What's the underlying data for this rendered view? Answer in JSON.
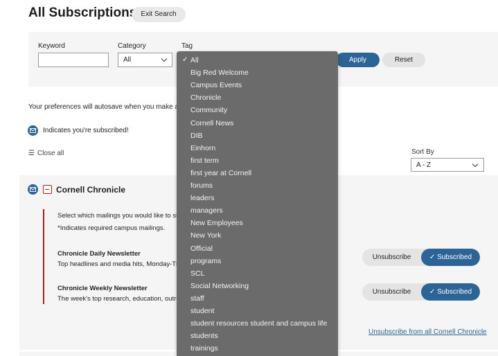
{
  "header": {
    "title": "All Subscriptions",
    "exit_search": "Exit Search"
  },
  "filters": {
    "keyword_label": "Keyword",
    "keyword_value": "",
    "category_label": "Category",
    "category_value": "All",
    "tag_label": "Tag",
    "apply": "Apply",
    "reset": "Reset"
  },
  "autosave_text": "Your preferences will autosave when you make a ch",
  "legend_text": "Indicates you're subscribed!",
  "close_all": "Close all",
  "sort": {
    "label": "Sort By",
    "value": "A - Z"
  },
  "section": {
    "title": "Cornell Chronicle",
    "intro": "Select which mailings you would like to su",
    "required_note": "*Indicates required campus mailings.",
    "newsletters": [
      {
        "name": "Chronicle Daily Newsletter",
        "desc": "Top headlines and media hits, Monday-Th",
        "unsubscribe": "Unsubscribe",
        "subscribed": "Subscribed"
      },
      {
        "name": "Chronicle Weekly Newsletter",
        "desc": "The week's top research, education, outre",
        "unsubscribe": "Unsubscribe",
        "subscribed": "Subscribed"
      }
    ],
    "unsubscribe_all": "Unsubscribe from all Cornell Chronicle"
  },
  "tag_menu": {
    "selected_index": 0,
    "items": [
      "All",
      "Big Red Welcome",
      "Campus Events",
      "Chronicle",
      "Community",
      "Cornell News",
      "DIB",
      "Einhorn",
      "first term",
      "first year at Cornell",
      "forums",
      "leaders",
      "managers",
      "New Employees",
      "New York",
      "Official",
      "programs",
      "SCL",
      "Social Networking",
      "staff",
      "student",
      "student resources student and campus life",
      "students",
      "trainings"
    ]
  },
  "colors": {
    "accent": "#2c6497",
    "cornell_red": "#b31b1b",
    "menu_bg": "#6b6b6b"
  }
}
